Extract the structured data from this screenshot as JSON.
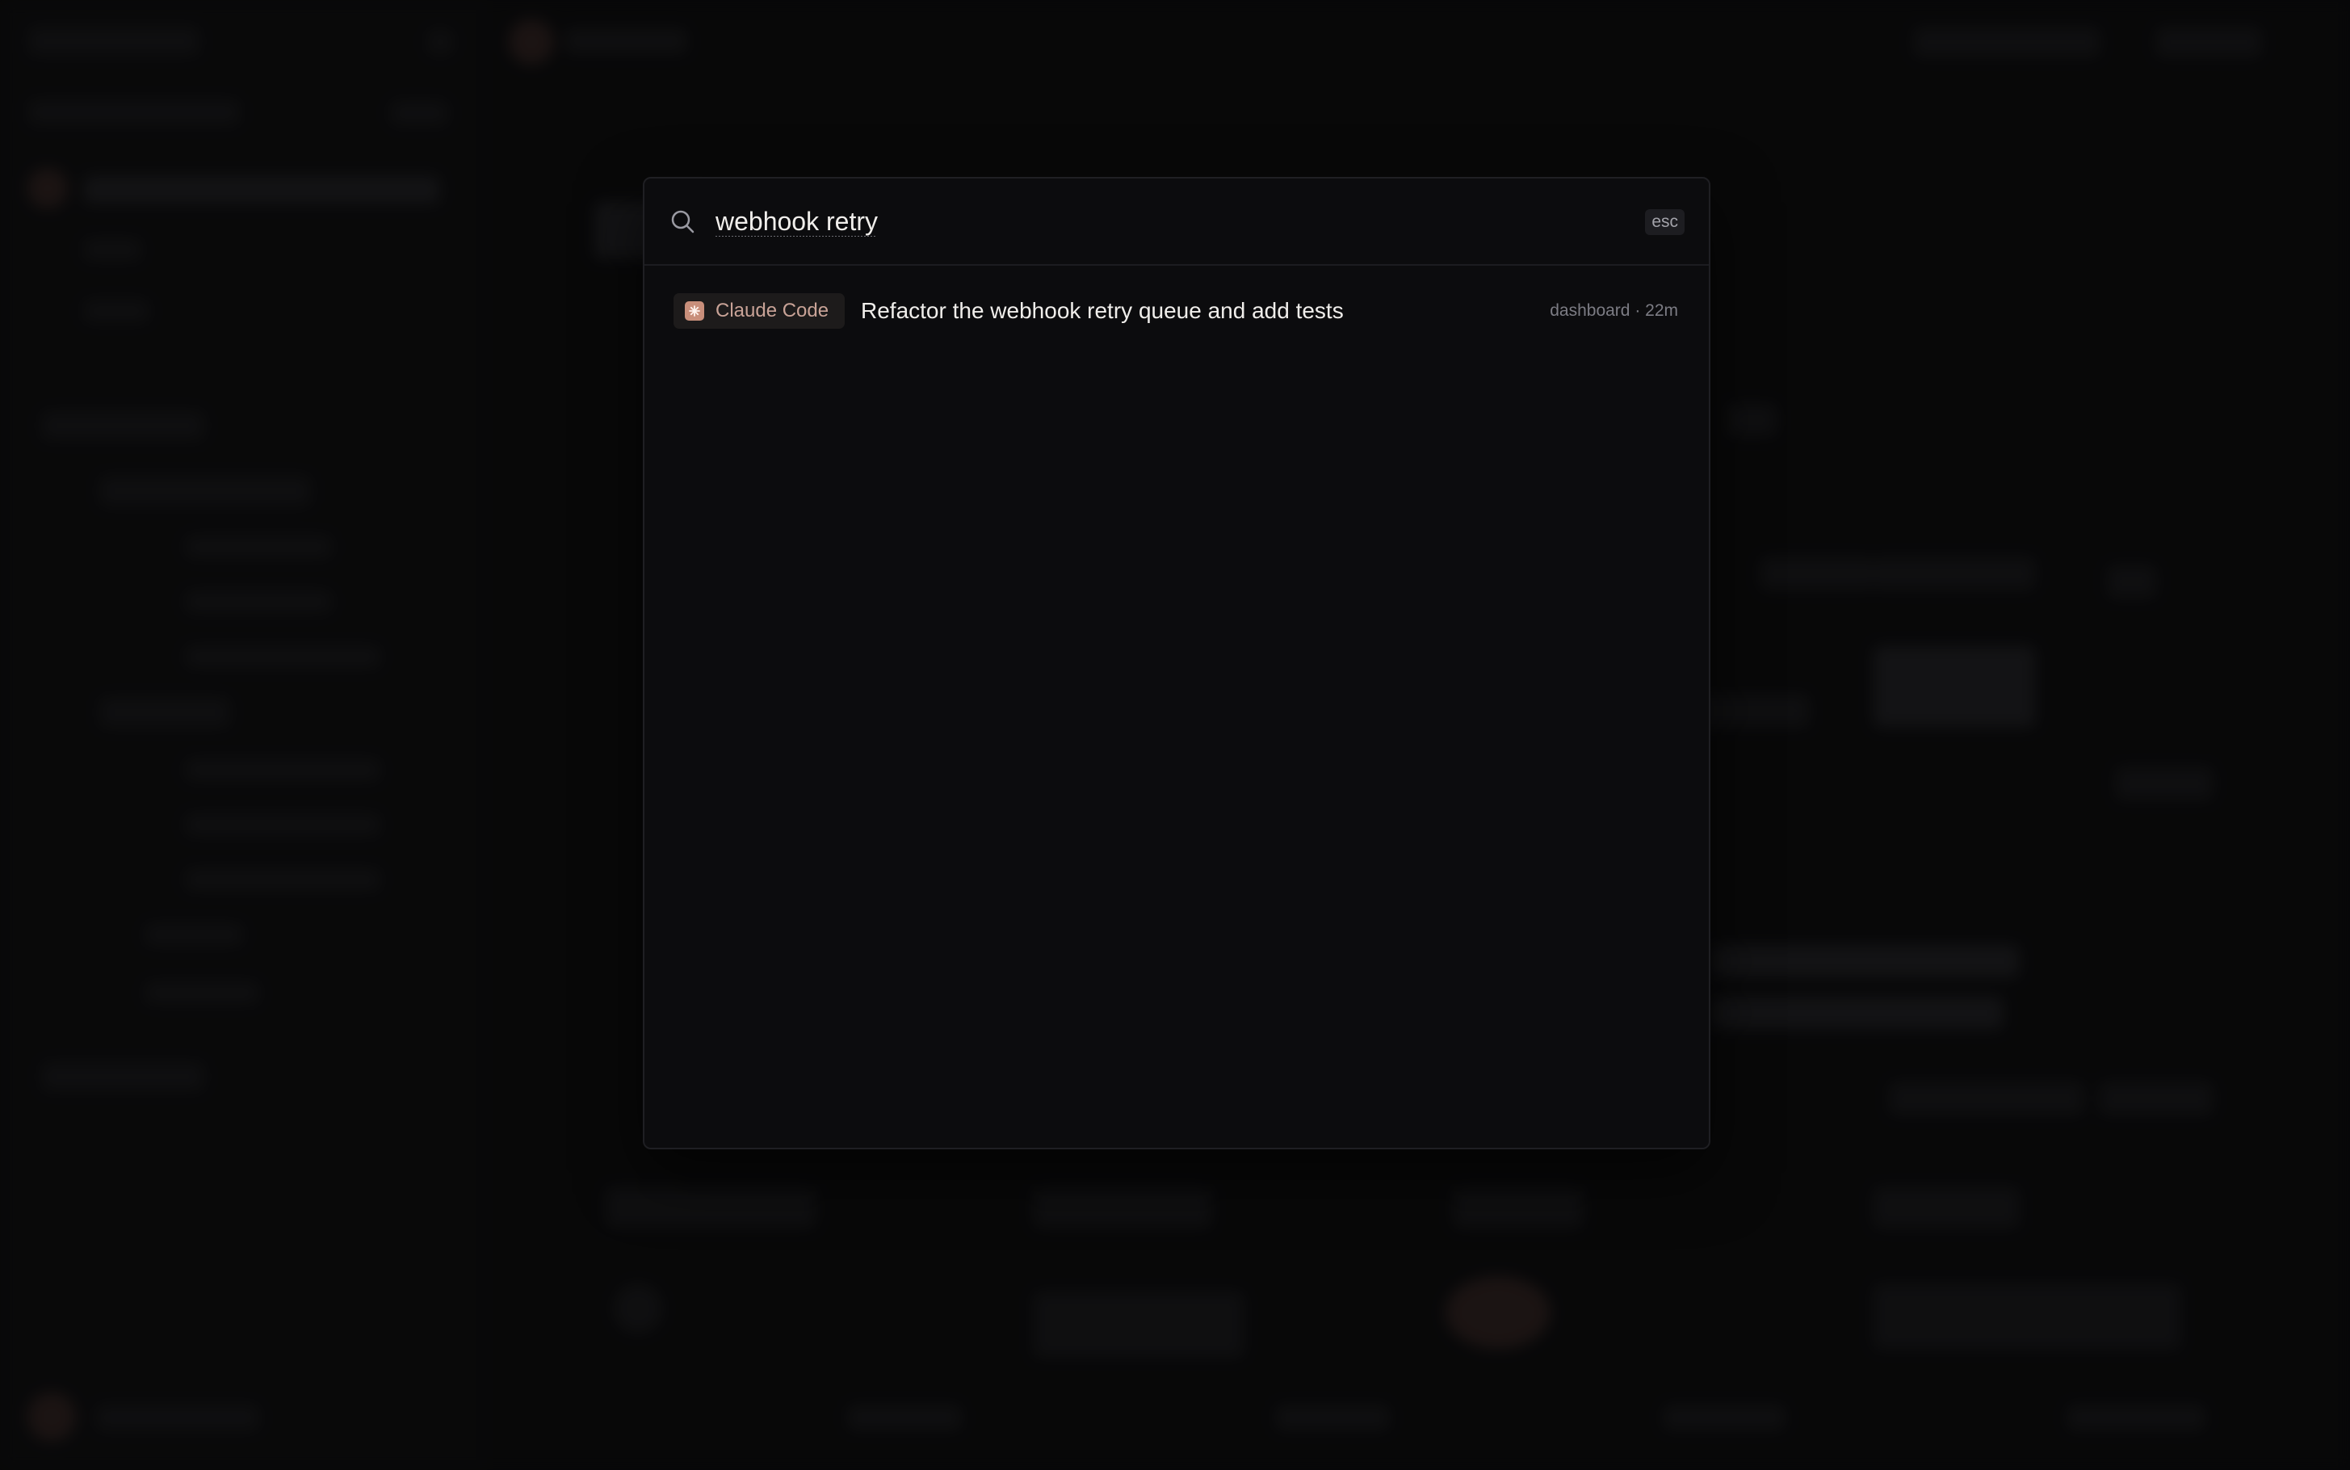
{
  "search": {
    "query": "webhook retry",
    "esc_label": "esc"
  },
  "results": [
    {
      "source": "Claude Code",
      "title": "Refactor the webhook retry queue and add tests",
      "meta": "dashboard · 22m"
    }
  ],
  "colors": {
    "accent": "#c98f7b",
    "background": "#0b0b0c",
    "palette_background": "#0c0c0e"
  },
  "icons": {
    "search": "search-icon",
    "source": "claude-code-icon"
  }
}
